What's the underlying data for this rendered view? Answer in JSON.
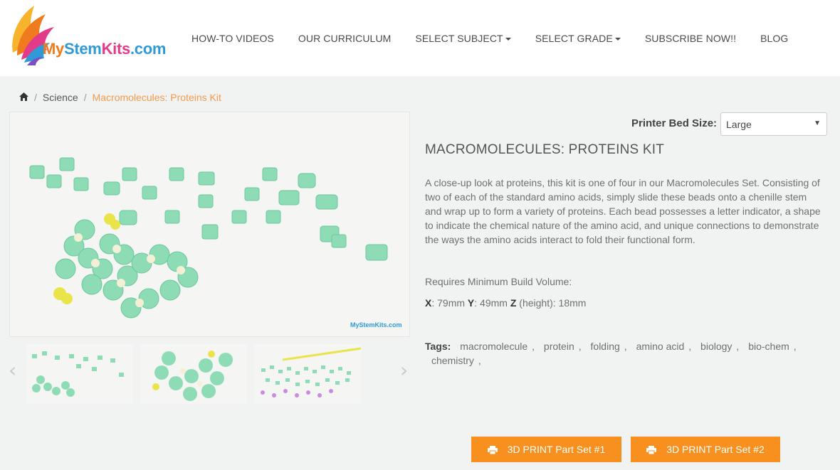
{
  "brand": {
    "logo_text_my": "My",
    "logo_text_stem": "Stem",
    "logo_text_kits": "Kits",
    "logo_text_com": ".com",
    "colors": {
      "orange": "#f7901e",
      "blue": "#2f9ad6",
      "pink": "#e13b8a"
    }
  },
  "nav": {
    "items": [
      {
        "label": "HOW-TO VIDEOS",
        "dropdown": false
      },
      {
        "label": "OUR CURRICULUM",
        "dropdown": false
      },
      {
        "label": "SELECT SUBJECT",
        "dropdown": true
      },
      {
        "label": "SELECT GRADE",
        "dropdown": true
      },
      {
        "label": "SUBSCRIBE NOW!!",
        "dropdown": false
      },
      {
        "label": "BLOG",
        "dropdown": false
      }
    ]
  },
  "breadcrumb": {
    "home_icon": "home-icon",
    "items": [
      "Science",
      "Macromolecules: Proteins Kit"
    ]
  },
  "gallery": {
    "watermark": "MyStemKits.com",
    "prev_icon": "chevron-left-icon",
    "next_icon": "chevron-right-icon"
  },
  "product": {
    "printer_bed_label": "Printer Bed Size:",
    "printer_bed_value": "Large",
    "title": "MACROMOLECULES: PROTEINS KIT",
    "description": "A close-up look at proteins, this kit is one of four in our Macromolecules Set. Consisting of two of each of the standard amino acids, simply slide these beads onto a chenille stem and wrap up to form a variety of proteins. Each bead possesses a letter indicator, a shape to indicate the chemical nature of the amino acid, and unique connections to demonstrate the ways the amino acids interact to fold their functional form.",
    "requires_label": "Requires Minimum Build Volume:",
    "dims": {
      "x_label": "X",
      "x_value": ": 79mm ",
      "y_label": "Y",
      "y_value": ": 49mm ",
      "z_label": "Z",
      "z_value": " (height): 18mm"
    },
    "tags_label": "Tags:",
    "tags": [
      "macromolecule",
      "protein",
      "folding",
      "amino acid",
      "biology",
      "bio-chem",
      "chemistry"
    ]
  },
  "buttons": [
    {
      "label": "3D PRINT Part Set #1",
      "icon": "printer-icon"
    },
    {
      "label": "3D PRINT Part Set #2",
      "icon": "printer-icon"
    }
  ]
}
